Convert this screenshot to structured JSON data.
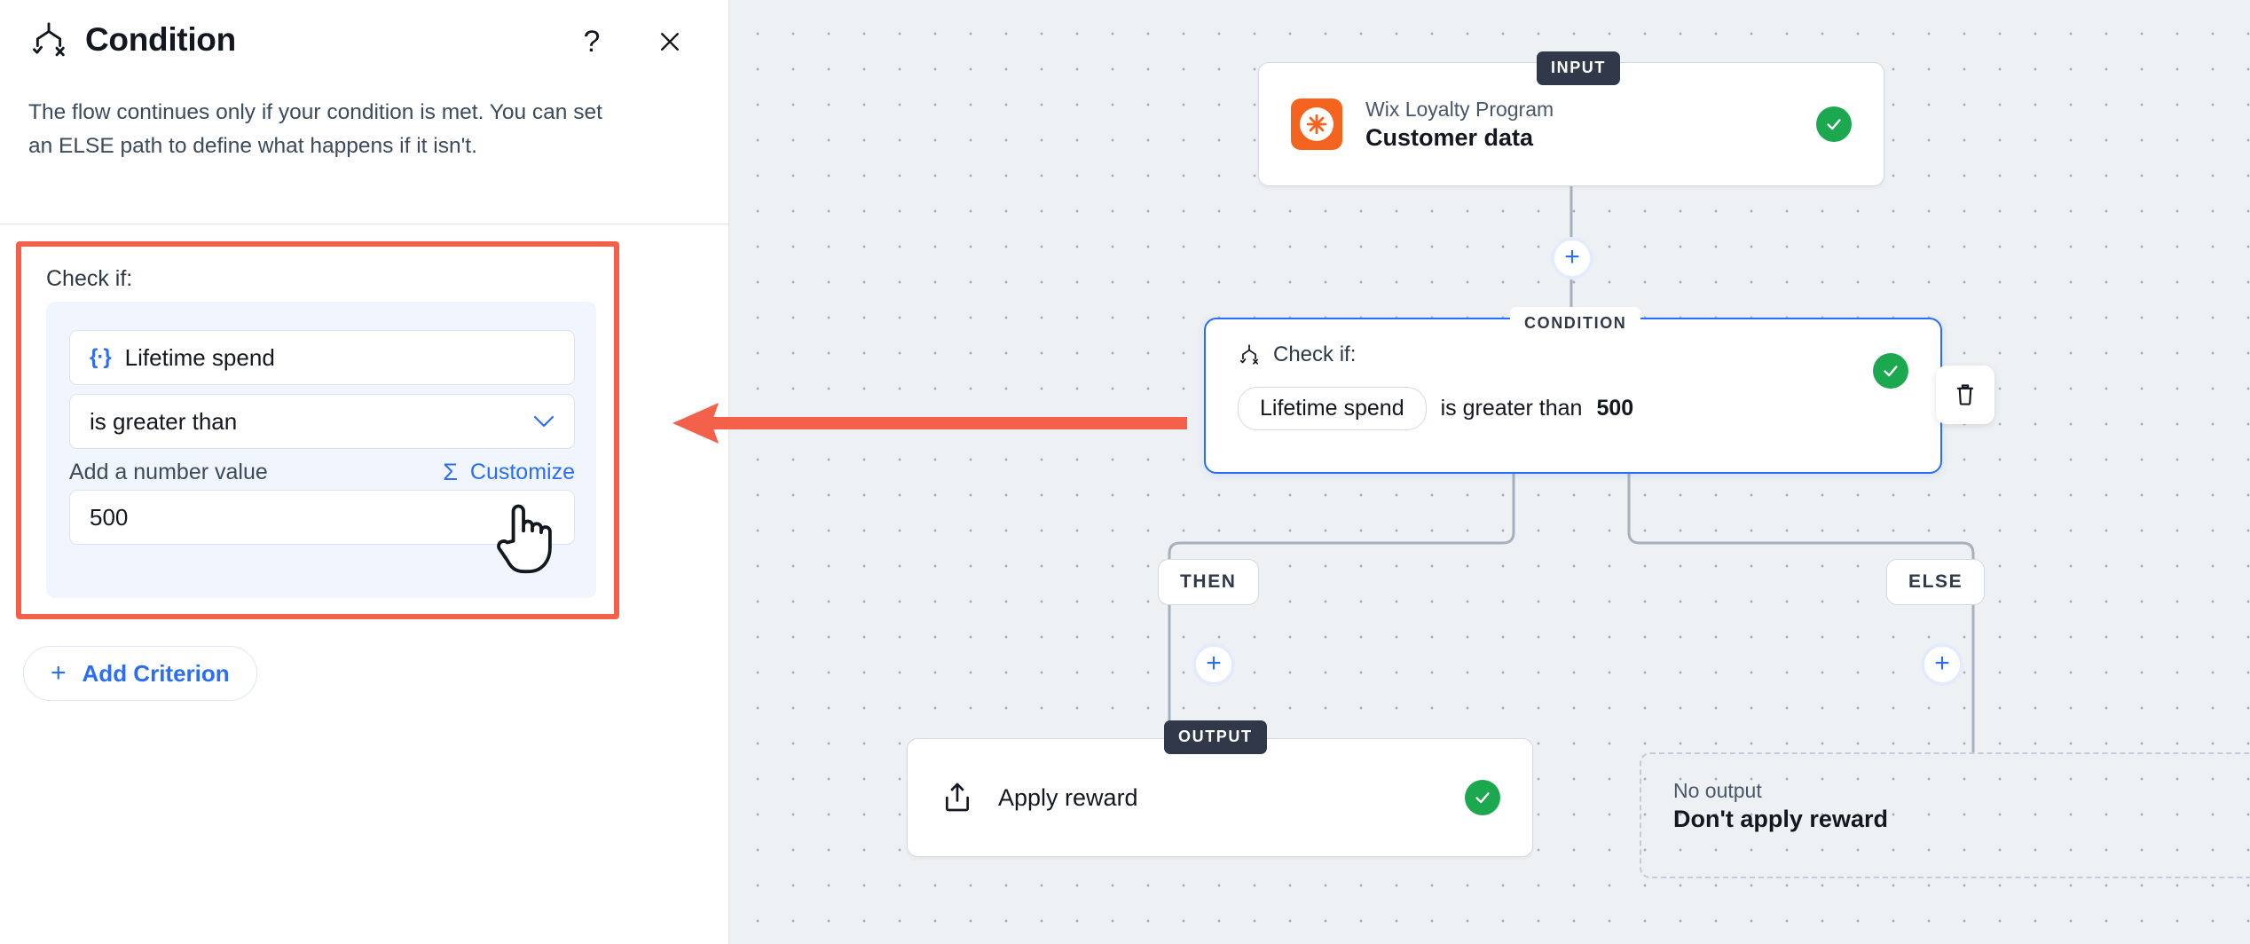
{
  "panel": {
    "icon": "condition-branch-icon",
    "title": "Condition",
    "help_icon": "question-mark-icon",
    "close_icon": "close-x-icon",
    "description": "The flow continues only if your condition is met. You can set an ELSE path to define what happens if it isn't.",
    "check_if_label": "Check if:",
    "variable_icon": "curly-braces-variable-icon",
    "variable_value": "Lifetime spend",
    "operator_value": "is greater than",
    "operator_chevron": "chevron-down-icon",
    "value_label": "Add a number value",
    "sigma_icon": "sigma-formula-icon",
    "customize_label": "Customize",
    "number_value": "500",
    "add_criterion_plus": "plus-icon",
    "add_criterion_label": "Add Criterion",
    "highlight_color": "#f4614a",
    "accent_color": "#2b6ef6"
  },
  "canvas": {
    "annotation_arrow_color": "#f4614a",
    "input_node": {
      "badge": "INPUT",
      "app_icon": "wix-star-logo-icon",
      "app_name": "Wix Loyalty Program",
      "title": "Customer data",
      "status_icon": "check-circle-icon",
      "status_color": "#1ba84f"
    },
    "connector_plus_icon": "plus-icon",
    "condition_node": {
      "badge": "CONDITION",
      "icon": "condition-branch-icon",
      "check_if_label": "Check if:",
      "token": "Lifetime spend",
      "operator": "is greater than",
      "value": "500",
      "status_icon": "check-circle-icon",
      "border_color": "#2b6ef6"
    },
    "delete_button_icon": "trash-icon",
    "then_chip": "THEN",
    "else_chip": "ELSE",
    "output_node": {
      "badge": "OUTPUT",
      "icon": "share-upload-icon",
      "title": "Apply reward",
      "status_icon": "check-circle-icon"
    },
    "else_node": {
      "subtitle": "No output",
      "title": "Don't apply reward"
    }
  }
}
